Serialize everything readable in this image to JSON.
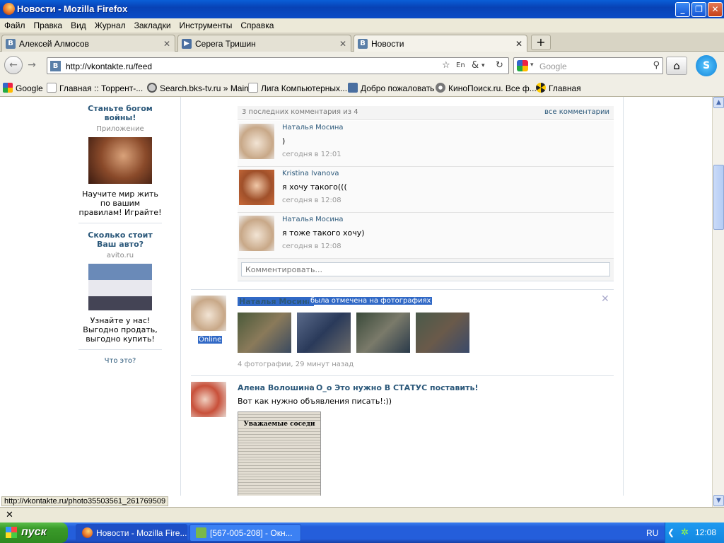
{
  "window": {
    "title": "Новости - Mozilla Firefox"
  },
  "menu": [
    "Файл",
    "Правка",
    "Вид",
    "Журнал",
    "Закладки",
    "Инструменты",
    "Справка"
  ],
  "tabs": [
    {
      "label": "Алексей Алмосов"
    },
    {
      "label": "Серега Тришин"
    },
    {
      "label": "Новости"
    }
  ],
  "nav": {
    "url": "http://vkontakte.ru/feed",
    "search_placeholder": "Google"
  },
  "bookmarks": [
    "Google",
    "Главная :: Торрент-...",
    "Search.bks-tv.ru » Main",
    "Лига Компьютерных...",
    "Добро пожаловать",
    "КиноПоиск.ru. Все ф...",
    "Главная"
  ],
  "sidebar": {
    "ads": [
      {
        "title": "Станьте богом войны!",
        "source": "Приложение",
        "desc": "Научите мир жить по вашим правилам! Играйте!"
      },
      {
        "title": "Сколько стоит Ваш авто?",
        "source": "avito.ru",
        "desc": "Узнайте у нас! Выгодно продать, выгодно купить!"
      }
    ],
    "what_is_it": "Что это?"
  },
  "comments": {
    "header": "3 последних комментария из 4",
    "all_link": "все комментарии",
    "items": [
      {
        "author": "Наталья Мосина",
        "text": ")",
        "time": "сегодня в 12:01"
      },
      {
        "author": "Kristina Ivanova",
        "text": "я хочу такого(((",
        "time": "сегодня в 12:08"
      },
      {
        "author": "Наталья Мосина",
        "text": "я тоже такого хочу)",
        "time": "сегодня в 12:08"
      }
    ],
    "placeholder": "Комментировать..."
  },
  "post1": {
    "author": "Наталья Мосина",
    "action": "была отмечена на фотографиях",
    "status": "Online",
    "meta": "4 фотографии, 29 минут назад"
  },
  "post2": {
    "author": "Алена Волошина",
    "title": "О_о Это нужно В СТАТУС поставить!",
    "text": "Вот как нужно объявления писать!:))",
    "photo_caption": "Уважаемые соседи"
  },
  "status": {
    "url": "http://vkontakte.ru/photo35503561_261769509"
  },
  "taskbar": {
    "start": "пуск",
    "tasks": [
      "Новости - Mozilla Fire...",
      "[567-005-208] - Окн..."
    ],
    "lang": "RU",
    "time": "12:08"
  }
}
